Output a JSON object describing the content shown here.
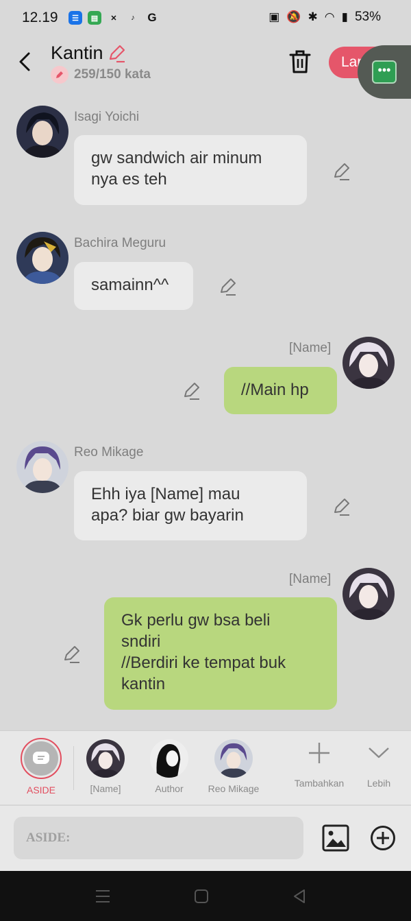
{
  "status_bar": {
    "time": "12.19",
    "battery": "53%",
    "apps": [
      {
        "icon": "outlook-icon",
        "glyph": "☰",
        "color": "#1a73e8"
      },
      {
        "icon": "messages-icon",
        "glyph": "▤",
        "color": "#34a853"
      },
      {
        "icon": "capcut-icon",
        "glyph": "✕",
        "color": "#111111"
      },
      {
        "icon": "tiktok-icon",
        "glyph": "♪",
        "color": "#111111"
      },
      {
        "icon": "google-icon",
        "glyph": "G",
        "color": "#111111"
      }
    ]
  },
  "header": {
    "title": "Kantin",
    "word_count": "259/150 kata",
    "action_label": "Lanjut",
    "accent": "#e5566a"
  },
  "messages": [
    {
      "sender": "Isagi Yoichi",
      "side": "left",
      "lines": [
        "gw sandwich air minum",
        "nya es teh"
      ],
      "avatar": "isagi-avatar"
    },
    {
      "sender": "Bachira Meguru",
      "side": "left",
      "lines": [
        "samainn^^"
      ],
      "avatar": "bachira-avatar"
    },
    {
      "sender": "[Name]",
      "side": "right",
      "lines": [
        "//Main hp"
      ],
      "avatar": "name-avatar"
    },
    {
      "sender": "Reo Mikage",
      "side": "left",
      "lines": [
        "Ehh iya [Name] mau",
        "apa? biar gw bayarin"
      ],
      "avatar": "reo-avatar"
    },
    {
      "sender": "[Name]",
      "side": "right",
      "lines": [
        "Gk perlu gw bsa beli",
        "sndiri",
        "//Berdiri ke tempat buk",
        "kantin"
      ],
      "avatar": "name-avatar"
    }
  ],
  "tray": {
    "items": [
      {
        "label": "ASIDE",
        "active": true
      },
      {
        "label": "[Name]"
      },
      {
        "label": "Author"
      },
      {
        "label": "Reo Mikage"
      },
      {
        "label": "Tambahkan"
      },
      {
        "label": "Lebih"
      }
    ]
  },
  "composer": {
    "placeholder": "ASIDE:"
  },
  "colors": {
    "bubble_left": "#ebebeb",
    "bubble_right": "#b8d77e",
    "background": "#d9d9d9"
  }
}
